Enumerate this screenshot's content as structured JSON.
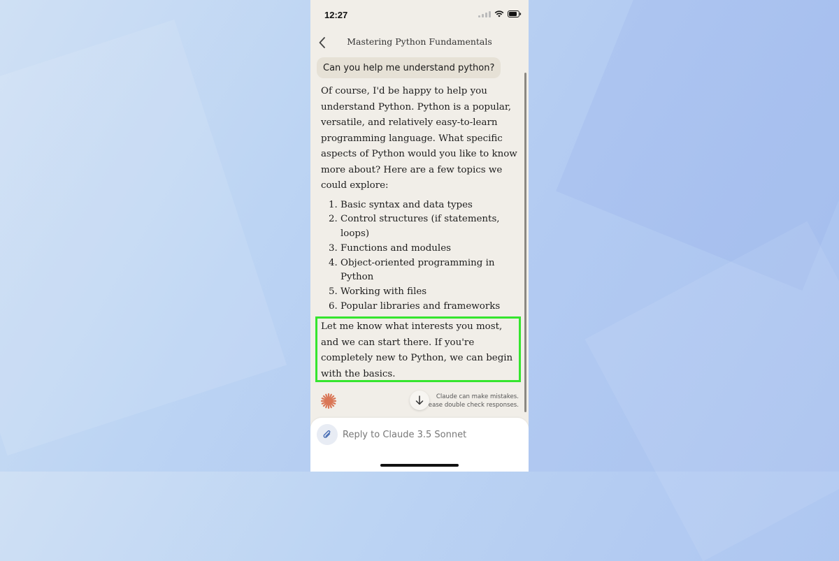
{
  "status_bar": {
    "time": "12:27"
  },
  "header": {
    "title": "Mastering Python Fundamentals"
  },
  "conversation": {
    "user_message": "Can you help me understand python?",
    "assistant_intro": "Of course, I'd be happy to help you understand Python. Python is a popular, versatile, and relatively easy-to-learn programming language. What specific aspects of Python would you like to know more about? Here are a few topics we could explore:",
    "topics": [
      "Basic syntax and data types",
      "Control structures (if statements, loops)",
      "Functions and modules",
      "Object-oriented programming in Python",
      "Working with files",
      "Popular libraries and frameworks"
    ],
    "assistant_closing": "Let me know what interests you most, and we can start there. If you're completely new to Python, we can begin with the basics."
  },
  "footer": {
    "disclaimer_line1": "Claude can make mistakes.",
    "disclaimer_line2": "ease double check responses."
  },
  "composer": {
    "placeholder": "Reply to Claude 3.5 Sonnet"
  },
  "colors": {
    "highlight": "#35e52e",
    "claude_logo": "#d97757",
    "background": "#f1eee8"
  },
  "icons": [
    "back-icon",
    "wifi-icon",
    "battery-icon",
    "claude-logo-icon",
    "arrow-down-icon",
    "paperclip-icon"
  ]
}
